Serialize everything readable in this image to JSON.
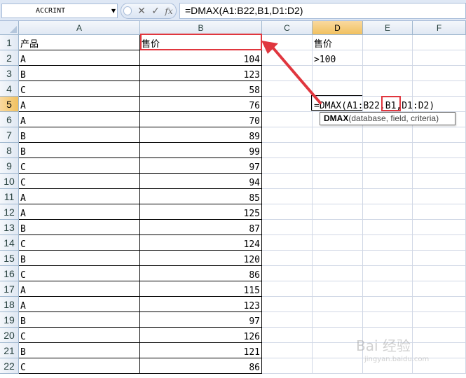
{
  "formula_bar": {
    "name_box": "ACCRINT",
    "cancel_icon": "✕",
    "enter_icon": "✓",
    "insert_function_icon": "fx",
    "formula": "=DMAX(A1:B22,B1,D1:D2)"
  },
  "columns": [
    "A",
    "B",
    "C",
    "D",
    "E",
    "F"
  ],
  "selected_column": "D",
  "selected_row": "5",
  "rows": [
    {
      "num": "1",
      "a": "产品",
      "b": "售价",
      "d": "售价"
    },
    {
      "num": "2",
      "a": "A",
      "b": "104",
      "d": ">100"
    },
    {
      "num": "3",
      "a": "B",
      "b": "123",
      "d": ""
    },
    {
      "num": "4",
      "a": "C",
      "b": "58",
      "d": ""
    },
    {
      "num": "5",
      "a": "A",
      "b": "76",
      "d": "=DMAX(A1:B22,B1,D1:D2)"
    },
    {
      "num": "6",
      "a": "A",
      "b": "70",
      "d": ""
    },
    {
      "num": "7",
      "a": "B",
      "b": "89",
      "d": ""
    },
    {
      "num": "8",
      "a": "B",
      "b": "99",
      "d": ""
    },
    {
      "num": "9",
      "a": "C",
      "b": "97",
      "d": ""
    },
    {
      "num": "10",
      "a": "C",
      "b": "94",
      "d": ""
    },
    {
      "num": "11",
      "a": "A",
      "b": "85",
      "d": ""
    },
    {
      "num": "12",
      "a": "A",
      "b": "125",
      "d": ""
    },
    {
      "num": "13",
      "a": "B",
      "b": "87",
      "d": ""
    },
    {
      "num": "14",
      "a": "C",
      "b": "124",
      "d": ""
    },
    {
      "num": "15",
      "a": "B",
      "b": "120",
      "d": ""
    },
    {
      "num": "16",
      "a": "C",
      "b": "86",
      "d": ""
    },
    {
      "num": "17",
      "a": "A",
      "b": "115",
      "d": ""
    },
    {
      "num": "18",
      "a": "A",
      "b": "123",
      "d": ""
    },
    {
      "num": "19",
      "a": "B",
      "b": "97",
      "d": ""
    },
    {
      "num": "20",
      "a": "C",
      "b": "126",
      "d": ""
    },
    {
      "num": "21",
      "a": "B",
      "b": "121",
      "d": ""
    },
    {
      "num": "22",
      "a": "C",
      "b": "86",
      "d": ""
    }
  ],
  "tooltip": {
    "function_name": "DMAX",
    "args": "(database, field, criteria)"
  },
  "watermark": {
    "text": "Bai 经验",
    "sub": "jingyan.baidu.com"
  },
  "colors": {
    "highlight_red": "#e0363e",
    "header_blue": "#e0e8f3",
    "header_selected": "#f1c15f"
  }
}
